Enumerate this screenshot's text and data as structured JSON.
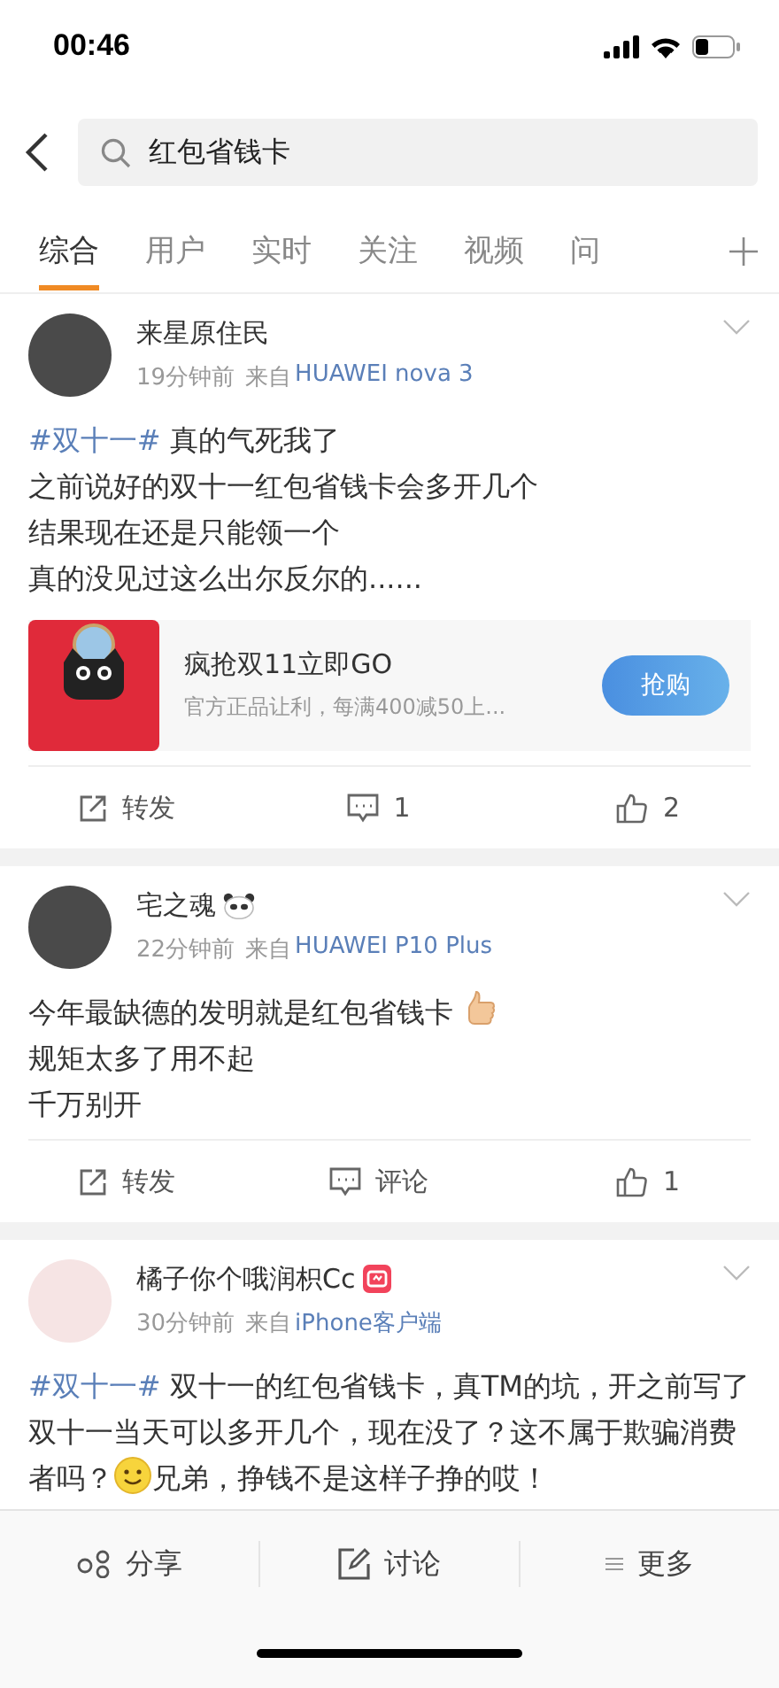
{
  "status_bar": {
    "time": "00:46"
  },
  "search": {
    "value": "红包省钱卡"
  },
  "tabs": [
    {
      "label": "综合",
      "selected": true
    },
    {
      "label": "用户",
      "selected": false
    },
    {
      "label": "实时",
      "selected": false
    },
    {
      "label": "关注",
      "selected": false
    },
    {
      "label": "视频",
      "selected": false
    },
    {
      "label": "问",
      "selected": false
    }
  ],
  "posts": [
    {
      "name": "来星原住民",
      "time": "19分钟前",
      "from_label": "来自",
      "source": "HUAWEI nova 3",
      "lines": [
        [
          {
            "kind": "topic",
            "text": "#双十一#"
          },
          {
            "kind": "text",
            "text": " 真的气死我了"
          }
        ],
        [
          {
            "kind": "text",
            "text": "之前说好的双十一红包省钱卡会多开几个"
          }
        ],
        [
          {
            "kind": "text",
            "text": "结果现在还是只能领一个"
          }
        ],
        [
          {
            "kind": "text",
            "text": "真的没见过这么出尔反尔的......"
          }
        ]
      ],
      "card": {
        "title": "疯抢双11立即GO",
        "desc": "官方正品让利，每满400减50上...",
        "button": "抢购"
      },
      "actions": [
        {
          "kind": "repost",
          "label": "转发"
        },
        {
          "kind": "comment",
          "label": "1"
        },
        {
          "kind": "like",
          "label": "2"
        }
      ]
    },
    {
      "name": "宅之魂",
      "badge": {
        "kind": "panda"
      },
      "time": "22分钟前",
      "from_label": "来自",
      "source": "HUAWEI P10 Plus",
      "lines": [
        [
          {
            "kind": "text",
            "text": "今年最缺德的发明就是红包省钱卡 "
          },
          {
            "kind": "thumb_emoji"
          }
        ],
        [
          {
            "kind": "text",
            "text": "规矩太多了用不起"
          }
        ],
        [
          {
            "kind": "text",
            "text": "千万别开"
          }
        ]
      ],
      "actions": [
        {
          "kind": "repost",
          "label": "转发"
        },
        {
          "kind": "comment",
          "label": "评论"
        },
        {
          "kind": "like",
          "label": "1"
        }
      ]
    },
    {
      "name": "橘子你个哦润枳Cc",
      "badge": {
        "kind": "member"
      },
      "time": "30分钟前",
      "from_label": "来自",
      "source": "iPhone客户端",
      "lines": [
        [
          {
            "kind": "topic",
            "text": "#双十一#"
          },
          {
            "kind": "text",
            "text": " 双十一的红包省钱卡，真TM的坑，开之前写了双十一当天可以多开几个，现在没了？这不属于欺骗消费者吗？"
          },
          {
            "kind": "smile_emoji"
          },
          {
            "kind": "text",
            "text": "兄弟，挣钱不是这样子挣的哎！"
          }
        ]
      ]
    }
  ],
  "bottom_bar": [
    {
      "kind": "share",
      "label": "分享"
    },
    {
      "kind": "discuss",
      "label": "讨论"
    },
    {
      "kind": "more",
      "label": "更多"
    }
  ]
}
